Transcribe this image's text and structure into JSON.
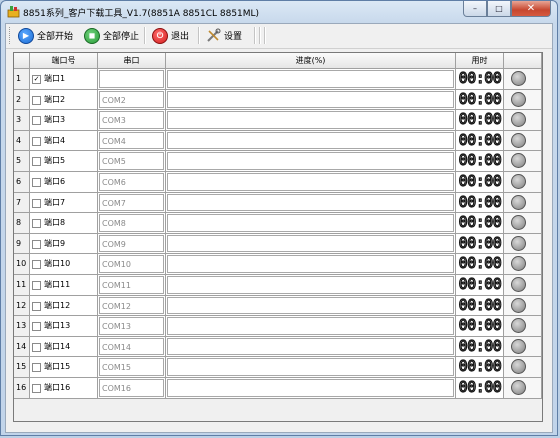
{
  "window": {
    "title": "8851系列_客户下载工具_V1.7(8851A 8851CL 8851ML)",
    "controls": {
      "minimize": "–",
      "maximize": "□",
      "close": "✕"
    }
  },
  "toolbar": {
    "start_all": "全部开始",
    "stop_all": "全部停止",
    "exit": "退出",
    "settings": "设置",
    "icons": {
      "start_all": "play-icon",
      "stop_all": "refresh-icon",
      "exit": "power-icon",
      "settings": "tools-icon"
    }
  },
  "columns": {
    "port_no": "端口号",
    "serial": "串口",
    "progress": "进度(%)",
    "time": "用时"
  },
  "rows": [
    {
      "num": "1",
      "checked": true,
      "checkmark": "✓",
      "port": "端口1",
      "com": "",
      "time": "00:00"
    },
    {
      "num": "2",
      "checked": false,
      "checkmark": "",
      "port": "端口2",
      "com": "COM2",
      "time": "00:00"
    },
    {
      "num": "3",
      "checked": false,
      "checkmark": "",
      "port": "端口3",
      "com": "COM3",
      "time": "00:00"
    },
    {
      "num": "4",
      "checked": false,
      "checkmark": "",
      "port": "端口4",
      "com": "COM4",
      "time": "00:00"
    },
    {
      "num": "5",
      "checked": false,
      "checkmark": "",
      "port": "端口5",
      "com": "COM5",
      "time": "00:00"
    },
    {
      "num": "6",
      "checked": false,
      "checkmark": "",
      "port": "端口6",
      "com": "COM6",
      "time": "00:00"
    },
    {
      "num": "7",
      "checked": false,
      "checkmark": "",
      "port": "端口7",
      "com": "COM7",
      "time": "00:00"
    },
    {
      "num": "8",
      "checked": false,
      "checkmark": "",
      "port": "端口8",
      "com": "COM8",
      "time": "00:00"
    },
    {
      "num": "9",
      "checked": false,
      "checkmark": "",
      "port": "端口9",
      "com": "COM9",
      "time": "00:00"
    },
    {
      "num": "10",
      "checked": false,
      "checkmark": "",
      "port": "端口10",
      "com": "COM10",
      "time": "00:00"
    },
    {
      "num": "11",
      "checked": false,
      "checkmark": "",
      "port": "端口11",
      "com": "COM11",
      "time": "00:00"
    },
    {
      "num": "12",
      "checked": false,
      "checkmark": "",
      "port": "端口12",
      "com": "COM12",
      "time": "00:00"
    },
    {
      "num": "13",
      "checked": false,
      "checkmark": "",
      "port": "端口13",
      "com": "COM13",
      "time": "00:00"
    },
    {
      "num": "14",
      "checked": false,
      "checkmark": "",
      "port": "端口14",
      "com": "COM14",
      "time": "00:00"
    },
    {
      "num": "15",
      "checked": false,
      "checkmark": "",
      "port": "端口15",
      "com": "COM15",
      "time": "00:00"
    },
    {
      "num": "16",
      "checked": false,
      "checkmark": "",
      "port": "端口16",
      "com": "COM16",
      "time": "00:00"
    }
  ],
  "colors": {
    "start": "#1e6fd6",
    "stop": "#2a9d3a",
    "exit": "#d42020",
    "status_idle": "#a6a6a6"
  }
}
